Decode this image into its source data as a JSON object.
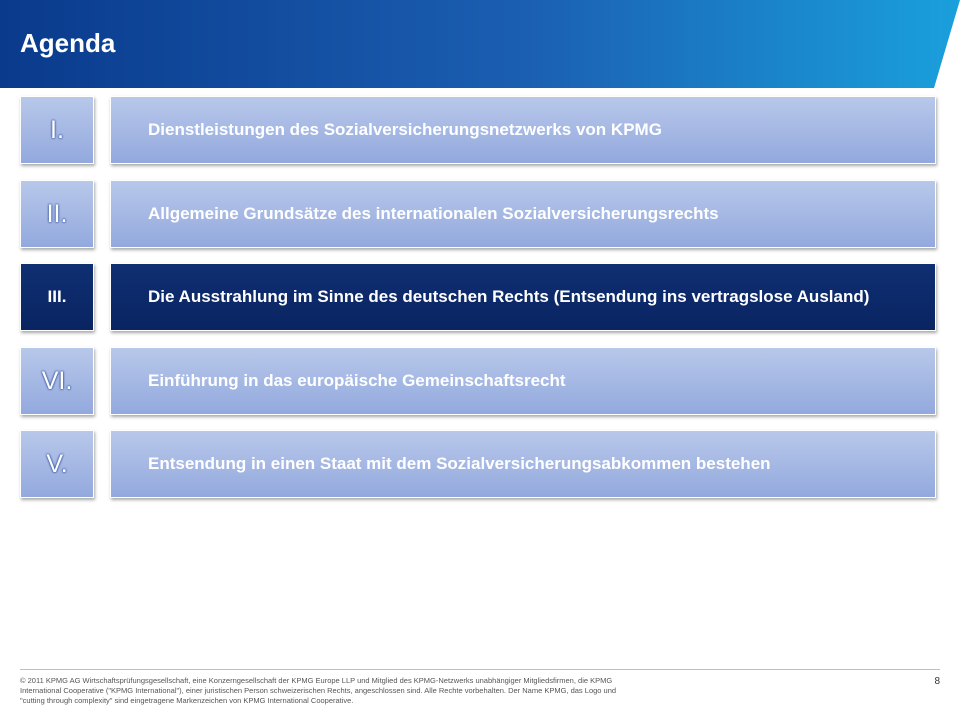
{
  "header": {
    "title": "Agenda"
  },
  "agenda": [
    {
      "num": "I.",
      "label": "Dienstleistungen des Sozialversicherungsnetzwerks von KPMG"
    },
    {
      "num": "II.",
      "label": "Allgemeine Grundsätze des internationalen Sozialversicherungsrechts"
    },
    {
      "num": "III.",
      "label": "Die Ausstrahlung im Sinne des deutschen Rechts (Entsendung ins vertragslose Ausland)"
    },
    {
      "num": "VI.",
      "label": "Einführung in das europäische Gemeinschaftsrecht"
    },
    {
      "num": "V.",
      "label": "Entsendung in einen Staat mit dem Sozialversicherungsabkommen bestehen"
    }
  ],
  "colors": {
    "header_start": "#0a3a8c",
    "header_end": "#1aa0dc",
    "item_inactive": "#a3b7e3",
    "item_active": "#0c2a6a"
  },
  "footer": {
    "copyright": "© 2011 KPMG AG Wirtschaftsprüfungsgesellschaft, eine Konzerngesellschaft der KPMG Europe LLP und Mitglied des KPMG-Netzwerks unabhängiger Mitgliedsfirmen, die KPMG International Cooperative (\"KPMG International\"), einer juristischen Person schweizerischen Rechts, angeschlossen sind. Alle Rechte vorbehalten. Der Name KPMG, das Logo und \"cutting through complexity\" sind eingetragene Markenzeichen von KPMG International Cooperative.",
    "page_number": "8"
  }
}
